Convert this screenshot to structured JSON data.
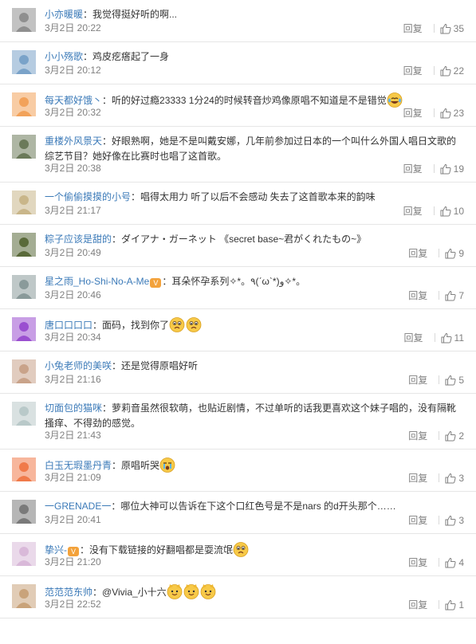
{
  "comments": [
    {
      "user": "小亦暖暖",
      "text": "：我觉得挺好听的啊...",
      "time": "3月2日 20:22",
      "reply": "回复",
      "likes": "35",
      "tall": false,
      "avatar": "#8f8f8f",
      "emojis": []
    },
    {
      "user": "小小殇歌",
      "text": "：鸡皮疙瘩起了一身",
      "time": "3月2日 20:12",
      "reply": "回复",
      "likes": "22",
      "tall": false,
      "avatar": "#7aa3c9",
      "emojis": []
    },
    {
      "user": "每天都好饿丶",
      "text": "：听的好过瘾23333  1分24的时候转音炒鸡像原唱不知道是不是错觉",
      "time": "3月2日 20:32",
      "reply": "回复",
      "likes": "23",
      "tall": false,
      "avatar": "#f2a25a",
      "emojis": [
        "laugh-cry"
      ]
    },
    {
      "user": "重楼外风景天",
      "text": "：好眼熟啊，她是不是叫戴安娜，几年前参加过日本的一个叫什么外国人唱日文歌的综艺节目？她好像在比赛时也唱了这首歌。",
      "time": "3月2日 20:38",
      "reply": "回复",
      "likes": "19",
      "tall": true,
      "avatar": "#6b7a5a",
      "emojis": []
    },
    {
      "user": "一个偷偷摸摸的小号",
      "text": "：唱得太用力  听了以后不会感动  失去了这首歌本来的韵味",
      "time": "3月2日 21:17",
      "reply": "回复",
      "likes": "10",
      "tall": false,
      "avatar": "#c9b68a",
      "emojis": []
    },
    {
      "user": "粽子应该是甜的",
      "text": "：ダイアナ・ガーネット 《secret base~君がくれたもの~》",
      "time": "3月2日 20:49",
      "reply": "回复",
      "likes": "9",
      "tall": false,
      "avatar": "#5a6a3a",
      "emojis": []
    },
    {
      "user": "星之雨_Ho-Shi-No-A-Me",
      "text": "：耳朵怀孕系列✧*。٩(ˊωˋ*)و✧*。",
      "time": "3月2日 20:46",
      "reply": "回复",
      "likes": "7",
      "tall": false,
      "avatar": "#8a9a9a",
      "emojis": [],
      "vbadge": "V"
    },
    {
      "user": "唐口口口口",
      "text": "：面码，找到你了",
      "time": "3月2日 20:34",
      "reply": "回复",
      "likes": "11",
      "tall": false,
      "avatar": "#9a4fd0",
      "emojis": [
        "sad",
        "sad"
      ]
    },
    {
      "user": "小兔老师的美咲",
      "text": "：还是觉得原唱好听",
      "time": "3月2日 21:16",
      "reply": "回复",
      "likes": "5",
      "tall": false,
      "avatar": "#c9a38a",
      "emojis": []
    },
    {
      "user": "切面包的猫咪",
      "text": "：萝莉音虽然很软萌，也贴近剧情，不过单听的话我更喜欢这个妹子唱的，没有隔靴搔痒、不得劲的感觉。",
      "time": "3月2日 21:43",
      "reply": "回复",
      "likes": "2",
      "tall": true,
      "avatar": "#b9c9c9",
      "emojis": []
    },
    {
      "user": "白玉无瑕墨丹青",
      "text": "：原唱听哭",
      "time": "3月2日 21:09",
      "reply": "回复",
      "likes": "3",
      "tall": false,
      "avatar": "#f07a4a",
      "emojis": [
        "cry"
      ]
    },
    {
      "user": "一GRENADE一",
      "text": "：哪位大神可以告诉在下这个口红色号是不是nars 的d开头那个……",
      "time": "3月2日 20:41",
      "reply": "回复",
      "likes": "3",
      "tall": false,
      "avatar": "#7a7a7a",
      "emojis": []
    },
    {
      "user": "挚兴-",
      "text": "：没有下载链接的好翻唱都是耍流氓",
      "time": "3月2日 21:20",
      "reply": "回复",
      "likes": "4",
      "tall": false,
      "avatar": "#d9b9d9",
      "emojis": [
        "sad"
      ],
      "vbadge": "V"
    },
    {
      "user": "范范范东帅",
      "text": "：@Vivia_小十六",
      "time": "3月2日 22:52",
      "reply": "回复",
      "likes": "1",
      "tall": false,
      "avatar": "#c9a37a",
      "emojis": [
        "cat",
        "cat",
        "cat"
      ]
    }
  ],
  "colors": {
    "username": "#3b7ab8",
    "meta": "#808080",
    "text": "#333333",
    "divider": "#e6e6e6"
  },
  "icons": {
    "like": "thumbs-up-icon"
  }
}
